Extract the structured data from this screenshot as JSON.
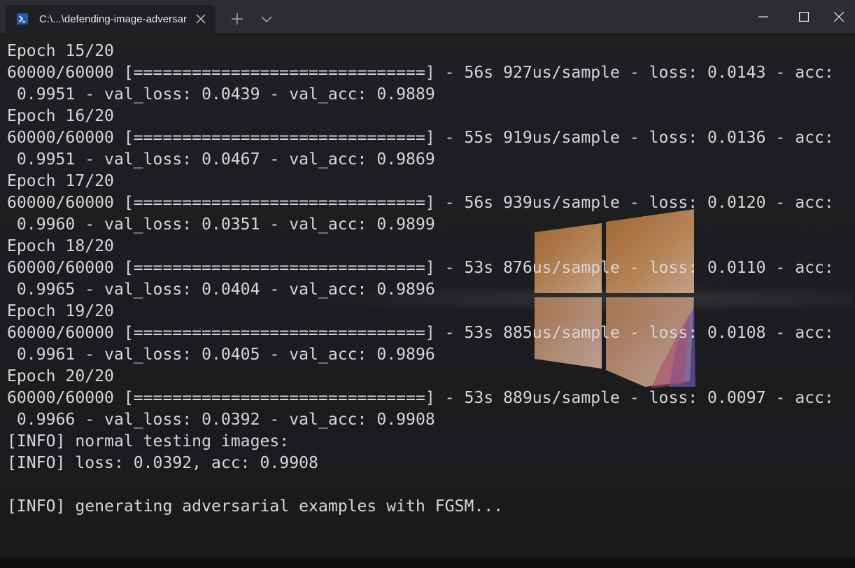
{
  "window": {
    "tab_title": "C:\\...\\defending-image-adversar",
    "tab_icon": "powershell-icon",
    "new_tab_icon": "plus-icon",
    "dropdown_icon": "chevron-down-icon",
    "controls": [
      "minimize-icon",
      "maximize-icon",
      "close-icon"
    ]
  },
  "colors": {
    "background": "#1b1c1f",
    "titlebar": "#2c2d30",
    "text": "#d6d6d6",
    "logo_orange": "#c9772f"
  },
  "terminal": {
    "lines": [
      "Epoch 15/20",
      "60000/60000 [==============================] - 56s 927us/sample - loss: 0.0143 - acc:",
      " 0.9951 - val_loss: 0.0439 - val_acc: 0.9889",
      "Epoch 16/20",
      "60000/60000 [==============================] - 55s 919us/sample - loss: 0.0136 - acc:",
      " 0.9951 - val_loss: 0.0467 - val_acc: 0.9869",
      "Epoch 17/20",
      "60000/60000 [==============================] - 56s 939us/sample - loss: 0.0120 - acc:",
      " 0.9960 - val_loss: 0.0351 - val_acc: 0.9899",
      "Epoch 18/20",
      "60000/60000 [==============================] - 53s 876us/sample - loss: 0.0110 - acc:",
      " 0.9965 - val_loss: 0.0404 - val_acc: 0.9896",
      "Epoch 19/20",
      "60000/60000 [==============================] - 53s 885us/sample - loss: 0.0108 - acc:",
      " 0.9961 - val_loss: 0.0405 - val_acc: 0.9896",
      "Epoch 20/20",
      "60000/60000 [==============================] - 53s 889us/sample - loss: 0.0097 - acc:",
      " 0.9966 - val_loss: 0.0392 - val_acc: 0.9908",
      "[INFO] normal testing images:",
      "[INFO] loss: 0.0392, acc: 0.9908",
      "",
      "[INFO] generating adversarial examples with FGSM..."
    ]
  }
}
